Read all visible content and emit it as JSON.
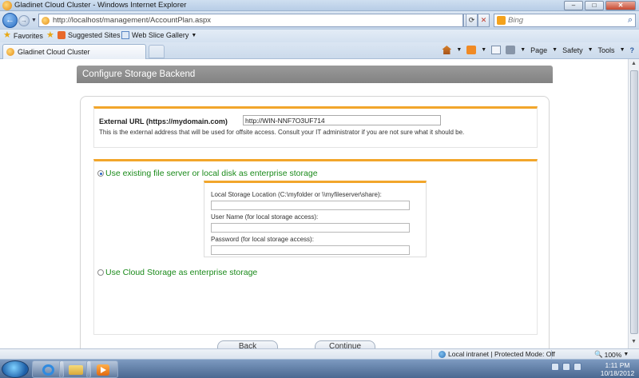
{
  "window": {
    "title": "Gladinet Cloud Cluster - Windows Internet Explorer",
    "min_label": "–",
    "max_label": "□",
    "close_label": "✕"
  },
  "address_bar": {
    "url": "http://localhost/management/AccountPlan.aspx",
    "refresh_label": "⟳",
    "stop_label": "✕",
    "search_placeholder": "Bing",
    "search_icon_glyph": "⌕"
  },
  "favorites_bar": {
    "favorites_label": "Favorites",
    "items": [
      {
        "label": "Suggested Sites"
      },
      {
        "label": "Web Slice Gallery"
      }
    ]
  },
  "tab": {
    "label": "Gladinet Cloud Cluster"
  },
  "command_bar": {
    "page_label": "Page",
    "safety_label": "Safety",
    "tools_label": "Tools",
    "help_label": "?"
  },
  "page": {
    "header": "Configure Storage Backend",
    "external_url": {
      "label": "External URL (https://mydomain.com)",
      "value": "http://WIN-NNF7O3UF714",
      "help": "This is the external address that will be used for offsite access. Consult your IT administrator if you are not sure what it should be."
    },
    "options": {
      "local_label": "Use existing file server or local disk as enterprise storage",
      "cloud_label": "Use Cloud Storage as enterprise storage",
      "selected": "local"
    },
    "local_storage": {
      "location_label": "Local Storage Location (C:\\myfolder or \\\\myfileserver\\share):",
      "location_value": "",
      "username_label": "User Name (for local storage access):",
      "username_value": "",
      "password_label": "Password (for local storage access):",
      "password_value": ""
    },
    "buttons": {
      "back_label": "Back",
      "continue_label": "Continue"
    }
  },
  "status_bar": {
    "zone_text": "Local intranet | Protected Mode: Off",
    "zoom_text": "100%"
  },
  "taskbar": {
    "time": "1:11 PM",
    "date": "10/18/2012"
  }
}
